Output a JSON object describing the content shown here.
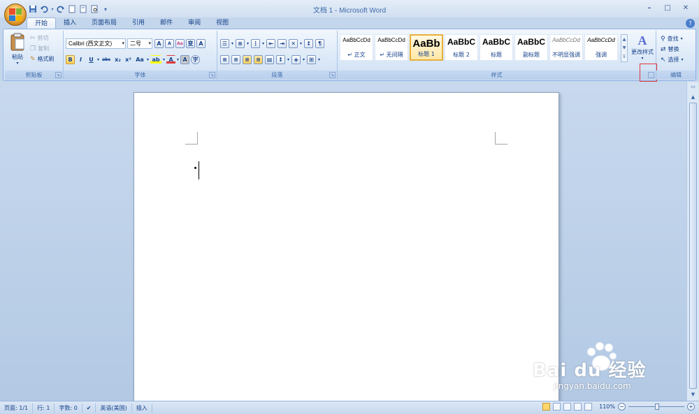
{
  "window": {
    "title": "文档 1 - Microsoft Word",
    "min": "–",
    "max": "□",
    "close": "✕"
  },
  "qat": {
    "items": [
      "save-icon",
      "undo-icon",
      "redo-icon",
      "new-icon",
      "open-icon",
      "print-preview-icon",
      "customize-icon"
    ]
  },
  "tabs": [
    {
      "label": "开始"
    },
    {
      "label": "插入"
    },
    {
      "label": "页面布局"
    },
    {
      "label": "引用"
    },
    {
      "label": "邮件"
    },
    {
      "label": "审阅"
    },
    {
      "label": "视图"
    }
  ],
  "ribbon": {
    "clipboard": {
      "label": "剪贴板",
      "paste": "粘贴",
      "cut": "剪切",
      "copy": "复制",
      "format_painter": "格式刷"
    },
    "font": {
      "label": "字体",
      "font_name": "Calibri (西文正文)",
      "font_size": "二号",
      "grow": "A",
      "shrink": "A",
      "clear": "Aa",
      "bold": "B",
      "italic": "I",
      "underline": "U",
      "strike": "abc",
      "subscript": "x₂",
      "superscript": "x²",
      "change_case": "Aa",
      "highlight": "ab",
      "font_color": "A",
      "char_shade": "A",
      "enclose": "字"
    },
    "paragraph": {
      "label": "段落"
    },
    "styles": {
      "label": "样式",
      "items": [
        {
          "sample": "AaBbCcDd",
          "name": "↵ 正文"
        },
        {
          "sample": "AaBbCcDd",
          "name": "↵ 无间隔"
        },
        {
          "sample": "AaBb",
          "name": "标题 1"
        },
        {
          "sample": "AaBbC",
          "name": "标题 2"
        },
        {
          "sample": "AaBbC",
          "name": "标题"
        },
        {
          "sample": "AaBbC",
          "name": "副标题"
        },
        {
          "sample": "AaBbCcDd",
          "name": "不明显强调"
        },
        {
          "sample": "AaBbCcDd",
          "name": "强调"
        }
      ],
      "change_styles": "更改样式"
    },
    "editing": {
      "label": "编辑",
      "find": "查找",
      "replace": "替换",
      "select": "选择"
    }
  },
  "status": {
    "page": "页面: 1/1",
    "line": "行: 1",
    "words": "字数: 0",
    "language": "英语(美国)",
    "mode": "插入",
    "zoom": "110%",
    "zoom_level_fraction": 0.52
  },
  "watermark": {
    "brand": "Bai du 经验",
    "url": "jingyan.baidu.com"
  },
  "colors": {
    "accent": "#15428b",
    "highlight_box": "#e0373a",
    "selected_style": "#e8b03c"
  }
}
